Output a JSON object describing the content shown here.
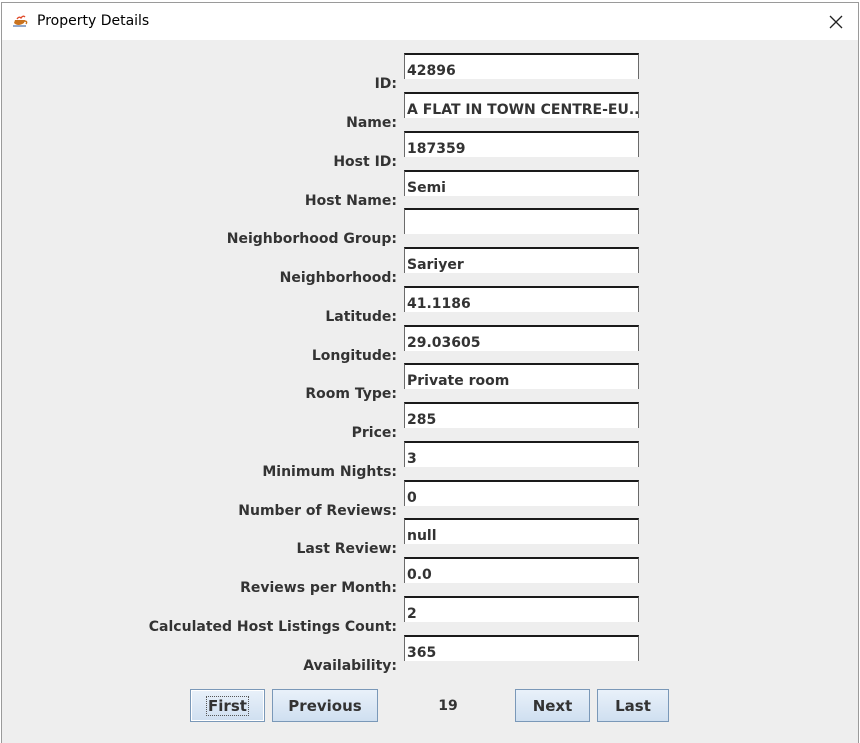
{
  "window": {
    "title": "Property Details",
    "app_icon": "java-cup-icon",
    "close_icon": "close-icon"
  },
  "fields": [
    {
      "label": "ID:",
      "value": "42896"
    },
    {
      "label": "Name:",
      "value": "A FLAT IN TOWN CENTRE-EU..."
    },
    {
      "label": "Host ID:",
      "value": "187359"
    },
    {
      "label": "Host Name:",
      "value": "Semi"
    },
    {
      "label": "Neighborhood Group:",
      "value": ""
    },
    {
      "label": "Neighborhood:",
      "value": "Sariyer"
    },
    {
      "label": "Latitude:",
      "value": "41.1186"
    },
    {
      "label": "Longitude:",
      "value": "29.03605"
    },
    {
      "label": "Room Type:",
      "value": "Private room"
    },
    {
      "label": "Price:",
      "value": "285"
    },
    {
      "label": "Minimum Nights:",
      "value": "3"
    },
    {
      "label": "Number of Reviews:",
      "value": "0"
    },
    {
      "label": "Last Review:",
      "value": "null"
    },
    {
      "label": "Reviews per Month:",
      "value": "0.0"
    },
    {
      "label": "Calculated Host Listings Count:",
      "value": "2"
    },
    {
      "label": "Availability:",
      "value": "365"
    }
  ],
  "nav": {
    "first": "First",
    "previous": "Previous",
    "page": "19",
    "next": "Next",
    "last": "Last"
  }
}
